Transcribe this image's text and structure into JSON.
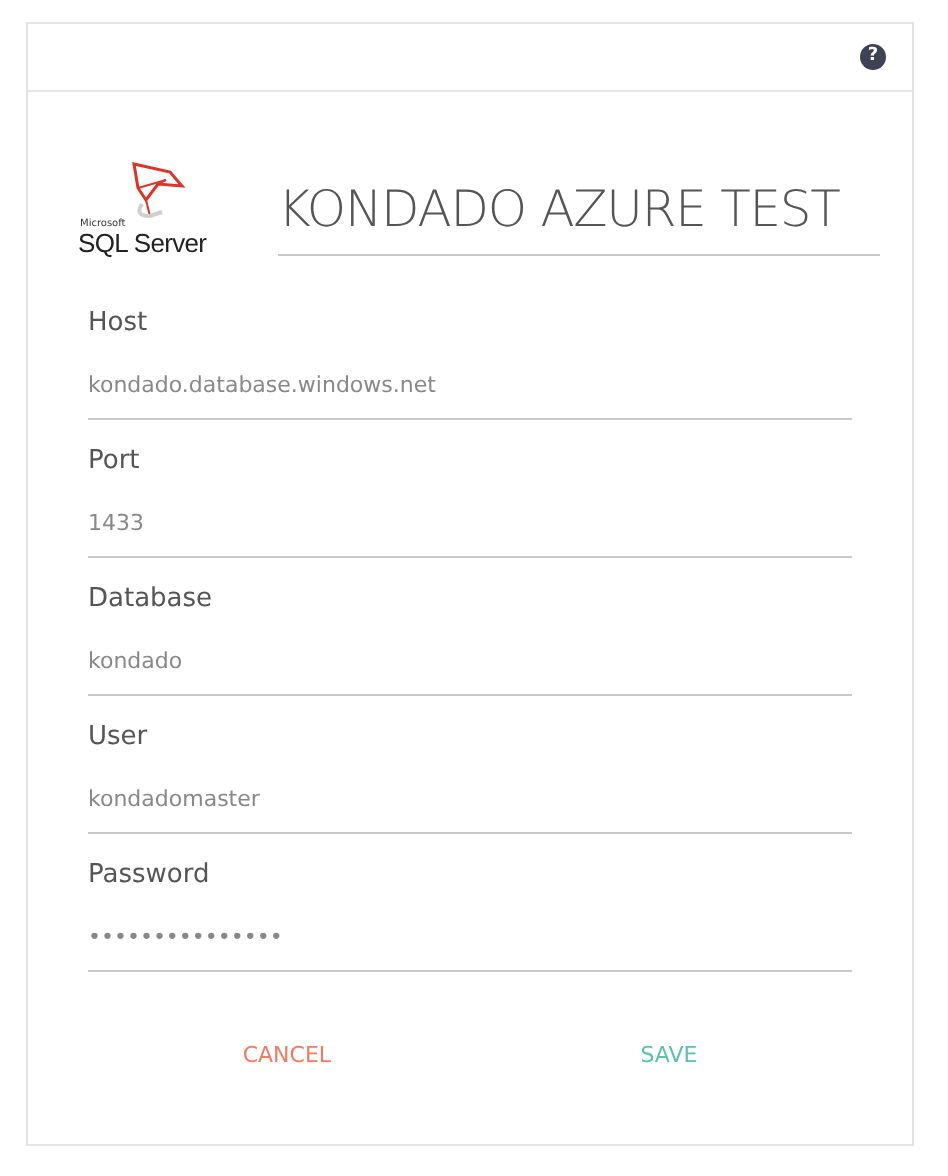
{
  "header": {
    "help": "?"
  },
  "logo": {
    "maker": "Microsoft",
    "product": "SQL Server"
  },
  "title": "KONDADO AZURE TEST",
  "fields": [
    {
      "label": "Host",
      "value": "kondado.database.windows.net"
    },
    {
      "label": "Port",
      "value": "1433"
    },
    {
      "label": "Database",
      "value": "kondado"
    },
    {
      "label": "User",
      "value": "kondadomaster"
    },
    {
      "label": "Password",
      "value": "•••••••••••••••"
    }
  ],
  "buttons": [
    {
      "label": "CANCEL",
      "kind": "cancel"
    },
    {
      "label": "SAVE",
      "kind": "save"
    }
  ]
}
